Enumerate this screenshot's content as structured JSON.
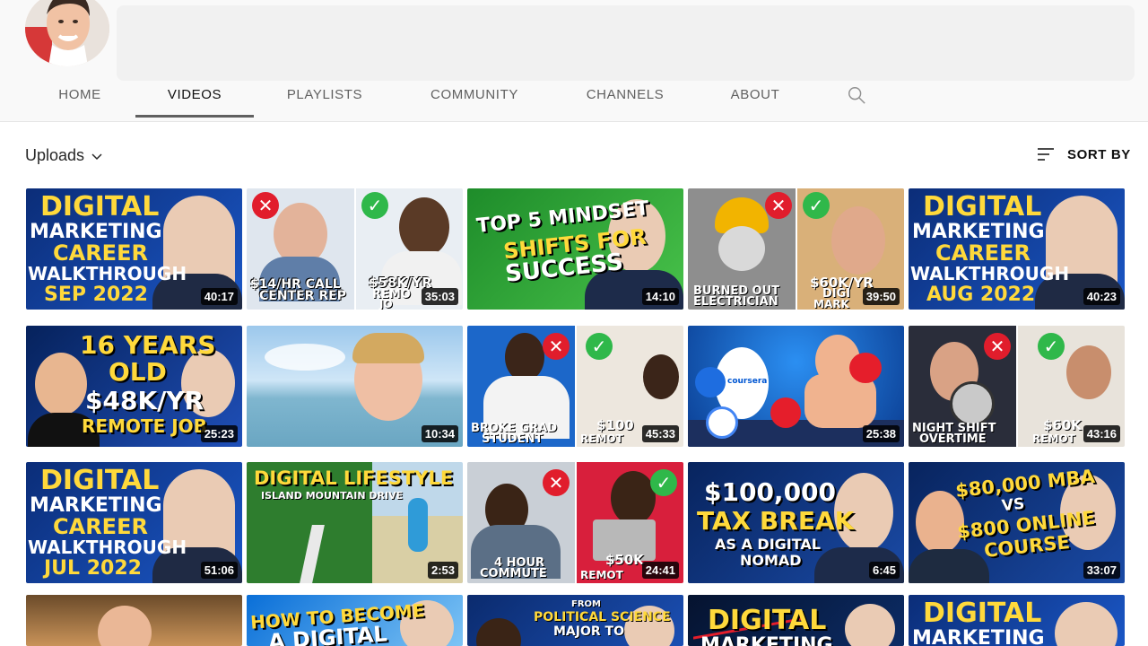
{
  "channel": {
    "tabs": [
      {
        "label": "HOME"
      },
      {
        "label": "VIDEOS"
      },
      {
        "label": "PLAYLISTS"
      },
      {
        "label": "COMMUNITY"
      },
      {
        "label": "CHANNELS"
      },
      {
        "label": "ABOUT"
      }
    ],
    "active_tab": "VIDEOS",
    "icons": {
      "search": "search-icon",
      "dropdown": "chevron-down-icon",
      "sort": "sort-icon"
    }
  },
  "filter": {
    "uploads_label": "Uploads",
    "sort_label": "SORT BY"
  },
  "videos": [
    {
      "duration": "40:17",
      "thumb_text": [
        "DIGITAL",
        "MARKETING",
        "CAREER",
        "WALKTHROUGH",
        "SEP 2022"
      ]
    },
    {
      "duration": "35:03",
      "thumb_text": [
        "$14/HR CALL",
        "CENTER REP",
        "$58K/YR",
        "REMO",
        "JO"
      ]
    },
    {
      "duration": "14:10",
      "thumb_text": [
        "TOP 5 MINDSET",
        "SHIFTS FOR",
        "SUCCESS"
      ]
    },
    {
      "duration": "39:50",
      "thumb_text": [
        "BURNED OUT",
        "ELECTRICIAN",
        "$60K/YR",
        "DIGI",
        "MARK"
      ]
    },
    {
      "duration": "40:23",
      "thumb_text": [
        "DIGITAL",
        "MARKETING",
        "CAREER",
        "WALKTHROUGH",
        "AUG 2022"
      ]
    },
    {
      "duration": "25:23",
      "thumb_text": [
        "16 YEARS",
        "OLD",
        "$48K/YR",
        "REMOTE JOB"
      ]
    },
    {
      "duration": "10:34",
      "thumb_text": []
    },
    {
      "duration": "45:33",
      "thumb_text": [
        "BROKE GRAD",
        "STUDENT",
        "$100",
        "REMOT"
      ]
    },
    {
      "duration": "25:38",
      "thumb_text": [
        "coursera"
      ]
    },
    {
      "duration": "43:16",
      "thumb_text": [
        "NIGHT SHIFT",
        "OVERTIME",
        "$60K",
        "REMOT"
      ]
    },
    {
      "duration": "51:06",
      "thumb_text": [
        "DIGITAL",
        "MARKETING",
        "CAREER",
        "WALKTHROUGH",
        "JUL 2022"
      ]
    },
    {
      "duration": "2:53",
      "thumb_text": [
        "DIGITAL LIFESTYLE",
        "ISLAND MOUNTAIN DRIVE"
      ]
    },
    {
      "duration": "24:41",
      "thumb_text": [
        "4 HOUR",
        "COMMUTE",
        "$50K",
        "REMOT"
      ]
    },
    {
      "duration": "6:45",
      "thumb_text": [
        "$100,000",
        "TAX BREAK",
        "AS A DIGITAL",
        "NOMAD"
      ]
    },
    {
      "duration": "33:07",
      "thumb_text": [
        "$80,000 MBA",
        "VS",
        "$800 ONLINE",
        "COURSE"
      ]
    },
    {
      "duration": "",
      "thumb_text": []
    },
    {
      "duration": "",
      "thumb_text": [
        "HOW TO BECOME",
        "A DIGITAL"
      ]
    },
    {
      "duration": "",
      "thumb_text": [
        "FROM",
        "POLITICAL SCIENCE",
        "MAJOR TO"
      ]
    },
    {
      "duration": "",
      "thumb_text": [
        "DIGITAL",
        "MARKETING"
      ]
    },
    {
      "duration": "",
      "thumb_text": [
        "DIGITAL",
        "MARKETING"
      ]
    }
  ]
}
